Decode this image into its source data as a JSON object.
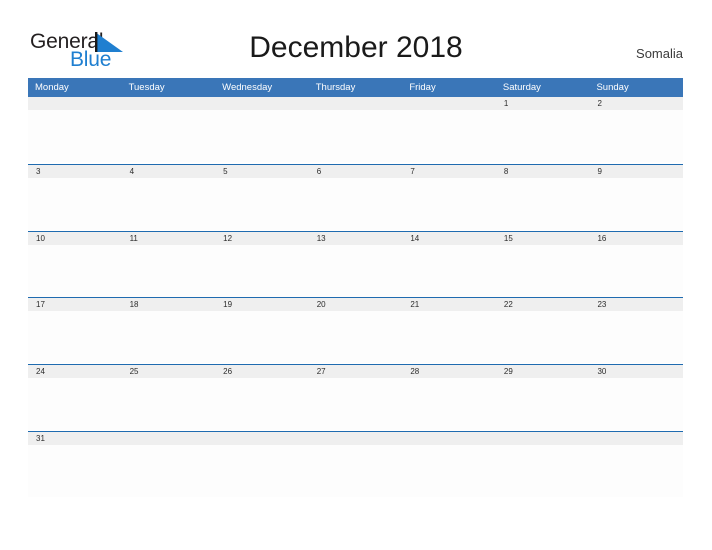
{
  "brand": {
    "name_top": "General",
    "name_bottom": "Blue",
    "flag_icon": "triangle-flag-icon",
    "color_top": "#231f20",
    "color_bottom": "#1f7fd0"
  },
  "header": {
    "title": "December 2018",
    "country": "Somalia"
  },
  "theme": {
    "header_blue": "#3a76b8",
    "rule_blue": "#1f6bb0",
    "band_gray": "#efefef",
    "cell_white": "#fdfdfd",
    "text_dark": "#2b2b2b"
  },
  "calendar": {
    "month": "December",
    "year": "2018",
    "weekdays": [
      "Monday",
      "Tuesday",
      "Wednesday",
      "Thursday",
      "Friday",
      "Saturday",
      "Sunday"
    ],
    "weeks": [
      [
        "",
        "",
        "",
        "",
        "",
        "1",
        "2"
      ],
      [
        "3",
        "4",
        "5",
        "6",
        "7",
        "8",
        "9"
      ],
      [
        "10",
        "11",
        "12",
        "13",
        "14",
        "15",
        "16"
      ],
      [
        "17",
        "18",
        "19",
        "20",
        "21",
        "22",
        "23"
      ],
      [
        "24",
        "25",
        "26",
        "27",
        "28",
        "29",
        "30"
      ],
      [
        "31",
        "",
        "",
        "",
        "",
        "",
        ""
      ]
    ]
  }
}
